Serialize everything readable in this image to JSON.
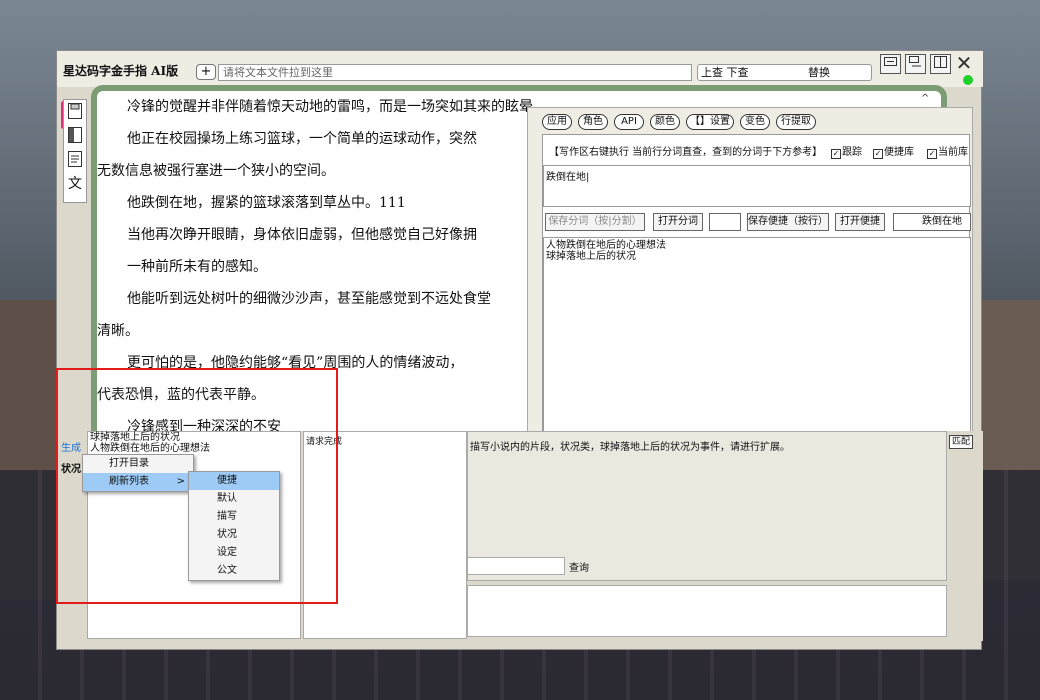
{
  "app": {
    "title": "星达码字金手指 AI版",
    "add_label": "+",
    "drop_placeholder": "请将文本文件拉到这里",
    "search_label": "上查 下查",
    "replace_label": "替换",
    "win_icons": [
      "minimize-icon",
      "restore-icon",
      "maximize-icon",
      "close-icon"
    ],
    "close_label": "✕",
    "status_color": "#1ed12a"
  },
  "sidebar": {
    "icons": [
      "save-icon",
      "panel-icon",
      "document-icon",
      "text-icon"
    ],
    "text_label": "文"
  },
  "editor": {
    "paragraphs": [
      "冷锋的觉醒并非伴随着惊天动地的雷鸣，而是一场突如其来的眩晕。",
      "他正在校园操场上练习篮球，一个简单的运球动作，突然",
      "无数信息被强行塞进一个狭小的空间。",
      "他跌倒在地，握紧的篮球滚落到草丛中。111",
      "当他再次睁开眼睛，身体依旧虚弱，但他感觉自己好像拥",
      "一种前所未有的感知。",
      "他能听到远处树叶的细微沙沙声，甚至能感觉到不远处食堂",
      "清晰。",
      "更可怕的是，他隐约能够“看见”周围的人的情绪波动，",
      "代表恐惧，蓝的代表平静。",
      "冷锋感到一种深深的不安"
    ],
    "scroll_up": "^"
  },
  "panel": {
    "tabs": [
      "应用",
      "角色",
      "API",
      "颜色",
      "【】设置",
      "变色",
      "行提取"
    ],
    "hint": "【写作区右键执行 当前行分词直查，查到的分词于下方参考】",
    "checkboxes": [
      {
        "label": "跟踪",
        "checked": true
      },
      {
        "label": "便捷库",
        "checked": true
      },
      {
        "label": "当前库",
        "checked": true
      }
    ],
    "input_text": "跌倒在地|",
    "buttons": {
      "save_split": "保存分词（按|分割）",
      "open_split": "打开分词",
      "save_note": "保存便捷（按行）",
      "open_note": "打开便捷",
      "current_word": "跌倒在地"
    },
    "reference_lines": [
      "人物跌倒在地后的心理想法",
      "球掉落地上后的状况"
    ]
  },
  "bottom": {
    "gen_label": "生成",
    "status_label": "状况",
    "list_items": [
      "球掉落地上后的状况",
      "人物跌倒在地后的心理想法"
    ],
    "result_label": "请求完成",
    "prompt_text": "描写小说内的片段，状况类，球掉落地上后的状况为事件，请进行扩展。",
    "query_label": "查询",
    "match_label": "匹配"
  },
  "context_menu": {
    "items": [
      "打开目录",
      "刷新列表"
    ],
    "submenu_arrow": ">",
    "submenu": [
      "便捷",
      "默认",
      "描写",
      "状况",
      "设定",
      "公文"
    ],
    "selected": "便捷"
  },
  "annotation_color": "#e21b1b"
}
